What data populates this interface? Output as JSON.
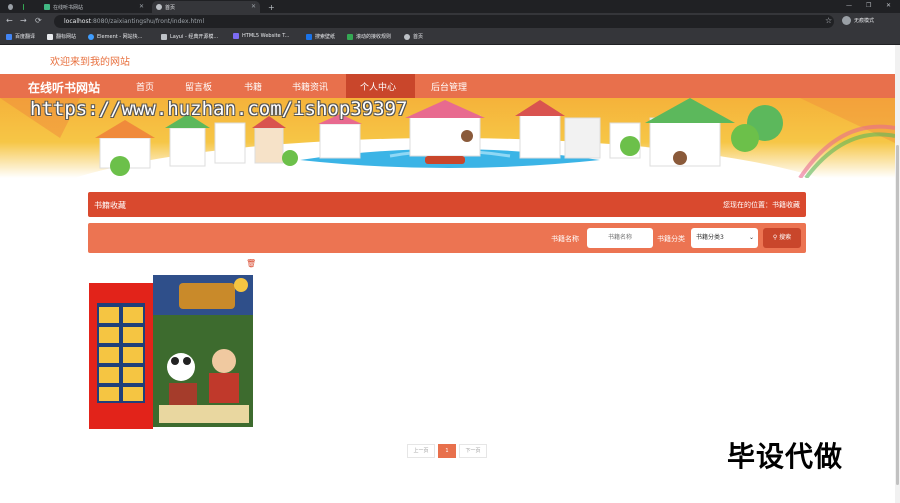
{
  "browser": {
    "tabs": [
      {
        "title": "",
        "active": false
      },
      {
        "title": "在线听书网站",
        "active": false
      },
      {
        "title": "首页",
        "active": true
      }
    ],
    "new_tab": "+",
    "window_controls": [
      "—",
      "❐",
      "✕"
    ],
    "nav": {
      "back": "←",
      "forward": "→",
      "reload": "⟳"
    },
    "url_host": "localhost",
    "url_path": ":8080/zaixiantingshu/front/index.html",
    "star": "☆",
    "profile_label": "无痕模式",
    "bookmarks": [
      "百度翻译",
      "翻标网站",
      "Element - 网站快...",
      "Layui - 经典开源模...",
      "HTML5 Website T...",
      "搜索壁纸",
      "滚动的接收规则",
      "首页"
    ]
  },
  "page": {
    "welcome": "欢迎来到我的网站",
    "brand": "在线听书网站",
    "nav_items": [
      "首页",
      "留言板",
      "书籍",
      "书籍资讯",
      "个人中心",
      "后台管理"
    ],
    "active_nav": "个人中心",
    "watermark": "https://www.huzhan.com/ishop39397",
    "section_title": "书籍收藏",
    "location_label": "您现在的位置：",
    "location_value": "书籍收藏",
    "search": {
      "name_label": "书籍名称",
      "name_placeholder": "书籍名称",
      "category_label": "书籍分类",
      "category_selected": "书籍分类3",
      "button_label": "搜索"
    },
    "delete_icon": "🗑",
    "pagination": {
      "prev": "上一页",
      "current": "1",
      "next": "下一页"
    },
    "overlay_text": "毕设代做"
  },
  "colors": {
    "brand_orange": "#e8704c",
    "dark_red": "#d9492e",
    "active_nav": "#c9462b",
    "welcome": "#e8713f"
  },
  "icons": {
    "delete": "trash-icon",
    "search": "search-icon",
    "star": "star-icon"
  }
}
